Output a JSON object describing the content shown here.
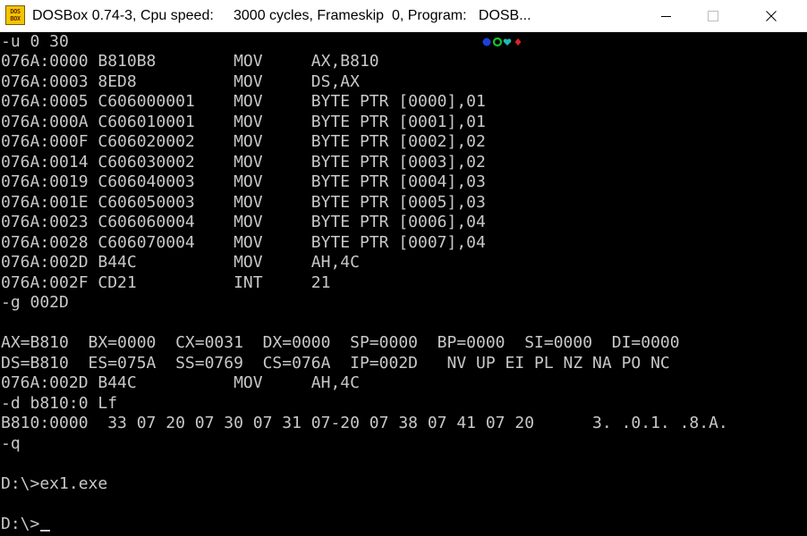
{
  "window": {
    "title": "DOSBox 0.74-3, Cpu speed:     3000 cycles, Frameskip  0, Program:   DOSB...",
    "icon_label_top": "DOS",
    "icon_label_bottom": "BOX",
    "icon": "dosbox-icon",
    "controls": [
      "minimize-icon",
      "maximize-icon",
      "close-icon"
    ]
  },
  "terminal": {
    "colors": {
      "background": "#000000",
      "foreground": "#c8c8c8"
    },
    "lines": [
      "-u 0 30",
      "076A:0000 B810B8        MOV     AX,B810",
      "076A:0003 8ED8          MOV     DS,AX",
      "076A:0005 C606000001    MOV     BYTE PTR [0000],01",
      "076A:000A C606010001    MOV     BYTE PTR [0001],01",
      "076A:000F C606020002    MOV     BYTE PTR [0002],02",
      "076A:0014 C606030002    MOV     BYTE PTR [0003],02",
      "076A:0019 C606040003    MOV     BYTE PTR [0004],03",
      "076A:001E C606050003    MOV     BYTE PTR [0005],03",
      "076A:0023 C606060004    MOV     BYTE PTR [0006],04",
      "076A:0028 C606070004    MOV     BYTE PTR [0007],04",
      "076A:002D B44C          MOV     AH,4C",
      "076A:002F CD21          INT     21",
      "-g 002D",
      "",
      "AX=B810  BX=0000  CX=0031  DX=0000  SP=0000  BP=0000  SI=0000  DI=0000",
      "DS=B810  ES=075A  SS=0769  CS=076A  IP=002D   NV UP EI PL NZ NA PO NC",
      "076A:002D B44C          MOV     AH,4C",
      "-d b810:0 Lf",
      "B810:0000  33 07 20 07 30 07 31 07-20 07 38 07 41 07 20      3. .0.1. .8.A.",
      "-q",
      "",
      "D:\\>ex1.exe",
      "",
      "D:\\>"
    ],
    "status_icons": [
      "blue-circle-icon",
      "green-ring-icon",
      "teal-heart-icon",
      "red-diamond-icon"
    ]
  }
}
